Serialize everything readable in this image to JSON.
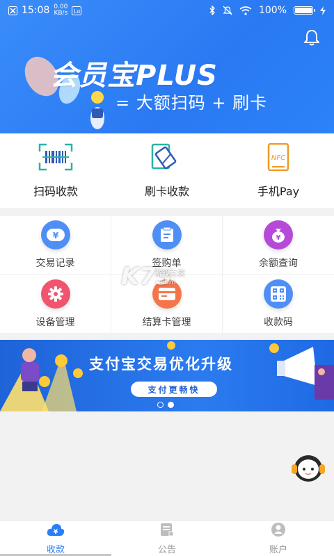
{
  "status_bar": {
    "time": "15:08",
    "net_speed_value": "0.00",
    "net_speed_unit": "KB/s",
    "battery": "100%",
    "battery_level": 1.0
  },
  "hero": {
    "title": "会员宝PLUS",
    "subtitle": "= 大额扫码 + 刷卡"
  },
  "main_actions": [
    {
      "label": "扫码收款",
      "icon": "qr-scan-icon"
    },
    {
      "label": "刷卡收款",
      "icon": "card-swipe-icon"
    },
    {
      "label": "手机Pay",
      "icon": "nfc-phone-icon",
      "icon_text": "NFC"
    }
  ],
  "grid": [
    {
      "label": "交易记录",
      "icon": "yuan-icon",
      "color": "#4f8ff5"
    },
    {
      "label": "签购单",
      "icon": "receipt-icon",
      "color": "#4f8ff5"
    },
    {
      "label": "余额查询",
      "icon": "money-bag-icon",
      "color": "#b54ad8"
    },
    {
      "label": "设备管理",
      "icon": "gear-icon",
      "color": "#f0546e"
    },
    {
      "label": "结算卡管理",
      "icon": "card-icon",
      "color": "#f5754a"
    },
    {
      "label": "收款码",
      "icon": "qr-code-icon",
      "color": "#4f8ff5"
    }
  ],
  "watermark": {
    "logo": "K73",
    "line1": "游戏之家",
    "line2": ".com"
  },
  "promo": {
    "title": "支付宝交易优化升级",
    "pill": "支付更畅快",
    "page_count": 2,
    "active_page": 2
  },
  "bottom_nav": [
    {
      "label": "收款",
      "icon": "cloud-yuan-icon",
      "active": true
    },
    {
      "label": "公告",
      "icon": "notice-icon",
      "active": false
    },
    {
      "label": "账户",
      "icon": "user-icon",
      "active": false
    }
  ],
  "colors": {
    "primary": "#2a7ff6",
    "hero_bg": "#3a8dfa",
    "promo_bg": "#1f63d8"
  }
}
